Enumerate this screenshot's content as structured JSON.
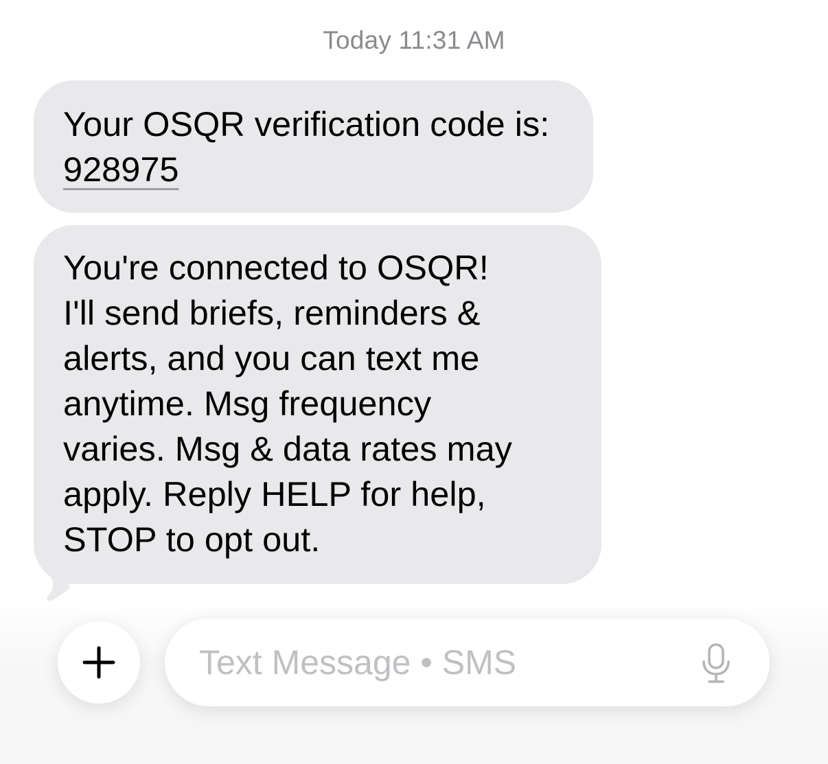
{
  "conversation": {
    "timestamp": "Today 11:31 AM",
    "messages": [
      {
        "text_before_code": "Your OSQR verification code is: ",
        "code": "928975"
      },
      {
        "lines": [
          "You're connected to OSQR!",
          "I'll send briefs, reminders &",
          "alerts, and you can text me",
          "anytime. Msg frequency",
          "varies. Msg & data rates may",
          "apply. Reply HELP for help,",
          "STOP to opt out."
        ]
      }
    ]
  },
  "composer": {
    "plus_icon": "plus-icon",
    "placeholder": "Text Message • SMS",
    "value": "",
    "mic_icon": "microphone-icon"
  },
  "colors": {
    "incoming_bubble": "#e9e9eb",
    "timestamp": "#8a8a8e",
    "placeholder": "#c0c0c4",
    "background": "#ffffff"
  }
}
